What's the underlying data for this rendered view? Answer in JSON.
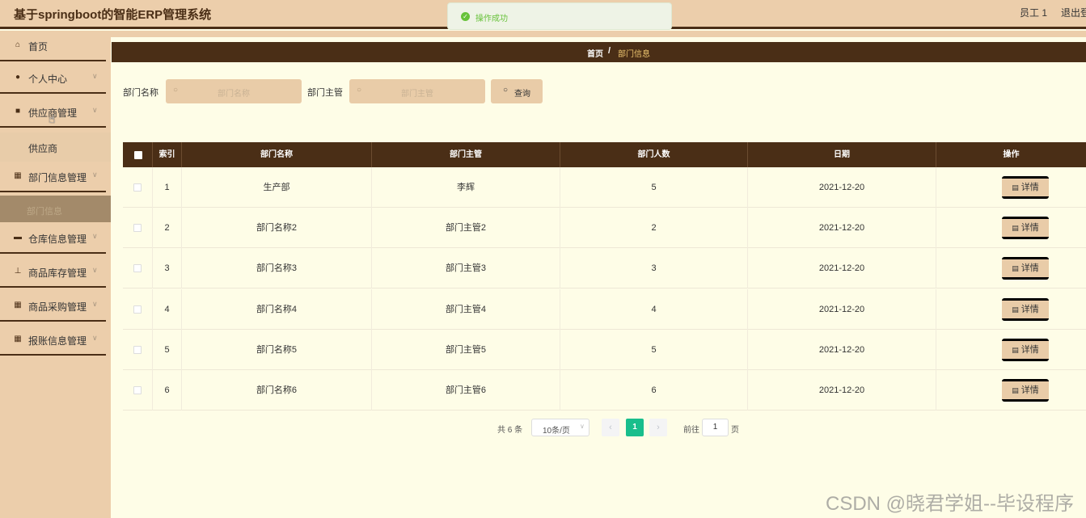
{
  "app": {
    "title": "基于springboot的智能ERP管理系统",
    "user": "员工 1",
    "logout": "退出登录"
  },
  "toast": {
    "message": "操作成功",
    "icon": "check-circle-icon",
    "color": "#67c23a"
  },
  "sidebar": {
    "items": [
      {
        "label": "首页",
        "icon": "home-icon",
        "chevron": ""
      },
      {
        "label": "个人中心",
        "icon": "user-icon",
        "chevron": "∨"
      },
      {
        "label": "供应商管理",
        "icon": "clipboard-icon",
        "chevron": "∨"
      },
      {
        "label": "部门信息管理",
        "icon": "grid-icon",
        "chevron": "∨"
      },
      {
        "label": "仓库信息管理",
        "icon": "box-icon",
        "chevron": "∨"
      },
      {
        "label": "商品库存管理",
        "icon": "stamp-icon",
        "chevron": "∨"
      },
      {
        "label": "商品采购管理",
        "icon": "grid-icon",
        "chevron": "∨"
      },
      {
        "label": "报账信息管理",
        "icon": "grid-icon",
        "chevron": "∨"
      }
    ],
    "sub_supplier": "供应商",
    "sub_dept": "部门信息"
  },
  "breadcrumb": {
    "home": "首页",
    "sep": "/",
    "current": "部门信息"
  },
  "search": {
    "name_label": "部门名称",
    "name_placeholder": "部门名称",
    "manager_label": "部门主管",
    "manager_placeholder": "部门主管",
    "query_label": "查询"
  },
  "table": {
    "headers": [
      "索引",
      "部门名称",
      "部门主管",
      "部门人数",
      "日期",
      "操作"
    ],
    "detail_label": "详情",
    "rows": [
      {
        "index": "1",
        "name": "生产部",
        "manager": "李辉",
        "count": "5",
        "date": "2021-12-20"
      },
      {
        "index": "2",
        "name": "部门名称2",
        "manager": "部门主管2",
        "count": "2",
        "date": "2021-12-20"
      },
      {
        "index": "3",
        "name": "部门名称3",
        "manager": "部门主管3",
        "count": "3",
        "date": "2021-12-20"
      },
      {
        "index": "4",
        "name": "部门名称4",
        "manager": "部门主管4",
        "count": "4",
        "date": "2021-12-20"
      },
      {
        "index": "5",
        "name": "部门名称5",
        "manager": "部门主管5",
        "count": "5",
        "date": "2021-12-20"
      },
      {
        "index": "6",
        "name": "部门名称6",
        "manager": "部门主管6",
        "count": "6",
        "date": "2021-12-20"
      }
    ]
  },
  "pager": {
    "total": "共 6 条",
    "page_size": "10条/页",
    "current": "1",
    "goto_label": "前往",
    "goto_value": "1",
    "page_unit": "页"
  },
  "watermark": "CSDN @晓君学姐--毕设程序",
  "colors": {
    "header_bg": "#ecceab",
    "dark_brown": "#4a2e16",
    "active_page": "#19be8c",
    "main_bg": "#fefde7"
  }
}
